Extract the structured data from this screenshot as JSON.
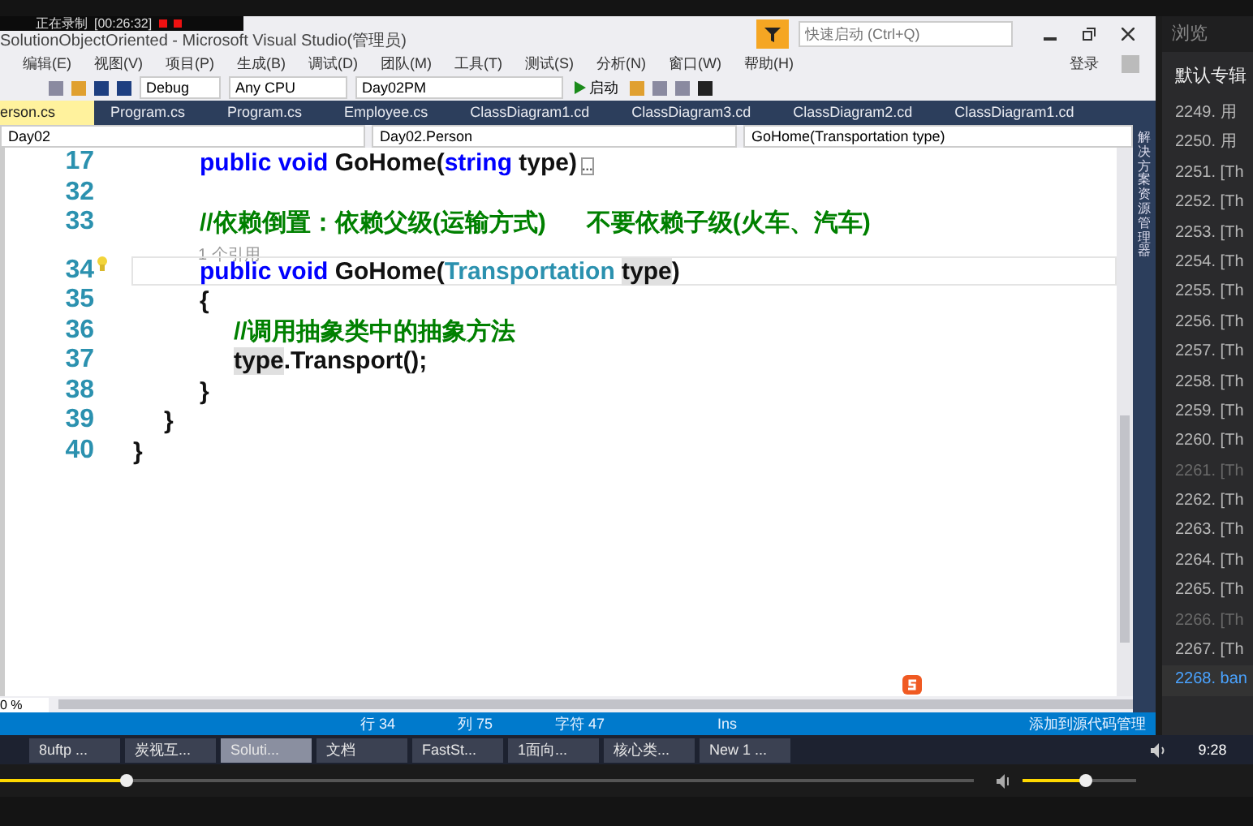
{
  "recording": {
    "label": "正在录制",
    "time": "[00:26:32]"
  },
  "window": {
    "title": "SolutionObjectOriented - Microsoft Visual Studio(管理员)",
    "quick_launch": {
      "placeholder": "快速启动 (Ctrl+Q)"
    },
    "login": "登录"
  },
  "menu": [
    "编辑(E)",
    "视图(V)",
    "项目(P)",
    "生成(B)",
    "调试(D)",
    "团队(M)",
    "工具(T)",
    "测试(S)",
    "分析(N)",
    "窗口(W)",
    "帮助(H)"
  ],
  "toolbar": {
    "configuration": "Debug",
    "platform": "Any CPU",
    "project": "Day02PM",
    "start": "启动"
  },
  "tabs": [
    {
      "label": "erson.cs",
      "selected": true
    },
    {
      "label": "Program.cs",
      "selected": false
    },
    {
      "label": "Program.cs",
      "selected": false
    },
    {
      "label": "Employee.cs",
      "selected": false
    },
    {
      "label": "ClassDiagram1.cd",
      "selected": false
    },
    {
      "label": "ClassDiagram3.cd",
      "selected": false
    },
    {
      "label": "ClassDiagram2.cd",
      "selected": false
    },
    {
      "label": "ClassDiagram1.cd",
      "selected": false
    }
  ],
  "nav": {
    "project": "Day02",
    "class": "Day02.Person",
    "member": "GoHome(Transportation type)"
  },
  "side_tab": "解决方案资源管理器",
  "code": [
    {
      "number": "17",
      "kind": "member",
      "current": false,
      "tokens": [
        {
          "text": "public void ",
          "kind": "keyword"
        },
        {
          "text": "GoHome(",
          "kind": "plain"
        },
        {
          "text": "string",
          "kind": "keyword"
        },
        {
          "text": " type)",
          "kind": "plain"
        },
        {
          "text": "...",
          "kind": "collapsed"
        }
      ]
    },
    {
      "number": "32",
      "kind": "member",
      "current": false
    },
    {
      "number": "33",
      "kind": "member",
      "current": false,
      "tokens": [
        {
          "text": "//依赖倒置：依赖父级(运输方式)      不要依赖子级(火车、汽车)",
          "kind": "comment"
        }
      ]
    },
    {
      "number": "34",
      "kind": "member",
      "current": true,
      "codelens": "1 个引用",
      "tokens": [
        {
          "text": "public void ",
          "kind": "keyword"
        },
        {
          "text": "GoHome(",
          "kind": "plain"
        },
        {
          "text": "Transportation ",
          "kind": "type"
        },
        {
          "text": "type",
          "kind": "highlight"
        },
        {
          "text": ")",
          "kind": "plain"
        }
      ]
    },
    {
      "number": "35",
      "kind": "member",
      "current": false,
      "tokens": [
        {
          "text": "{",
          "kind": "plain"
        }
      ]
    },
    {
      "number": "36",
      "kind": "body",
      "current": false,
      "tokens": [
        {
          "text": "//调用抽象类中的抽象方法",
          "kind": "comment"
        }
      ]
    },
    {
      "number": "37",
      "kind": "body",
      "current": false,
      "tokens": [
        {
          "text": "type",
          "kind": "highlight"
        },
        {
          "text": ".Transport();",
          "kind": "plain"
        }
      ]
    },
    {
      "number": "38",
      "kind": "member",
      "current": false,
      "tokens": [
        {
          "text": "}",
          "kind": "plain"
        }
      ]
    },
    {
      "number": "39",
      "kind": "class",
      "current": false,
      "tokens": [
        {
          "text": "}",
          "kind": "plain"
        }
      ]
    },
    {
      "number": "40",
      "kind": "namespace",
      "current": false,
      "tokens": [
        {
          "text": "}",
          "kind": "plain"
        }
      ]
    }
  ],
  "zoom": "0 %",
  "status_bar": {
    "line": "行 34",
    "column": "列 75",
    "char": "字符 47",
    "mode": "Ins",
    "source_control": "添加到源代码管理"
  },
  "taskbar": [
    {
      "label": "8uftp ...",
      "selected": false
    },
    {
      "label": "炭视互...",
      "selected": false
    },
    {
      "label": "Soluti...",
      "selected": true
    },
    {
      "label": "文档",
      "selected": false
    },
    {
      "label": "FastSt...",
      "selected": false
    },
    {
      "label": "1面向...",
      "selected": false
    },
    {
      "label": "核心类...",
      "selected": false
    },
    {
      "label": "New 1 ...",
      "selected": false
    }
  ],
  "clock": "9:28",
  "player": {
    "progress": {
      "level": 0.13
    },
    "volume": {
      "level": 0.55
    }
  },
  "panel": {
    "title": "浏览",
    "heading": "默认专辑",
    "items": [
      {
        "label": "2249. 用",
        "dimmed": false,
        "selected": false
      },
      {
        "label": "2250. 用",
        "dimmed": false,
        "selected": false
      },
      {
        "label": "2251. [Th",
        "dimmed": false,
        "selected": false
      },
      {
        "label": "2252. [Th",
        "dimmed": false,
        "selected": false
      },
      {
        "label": "2253. [Th",
        "dimmed": false,
        "selected": false
      },
      {
        "label": "2254. [Th",
        "dimmed": false,
        "selected": false
      },
      {
        "label": "2255. [Th",
        "dimmed": false,
        "selected": false
      },
      {
        "label": "2256. [Th",
        "dimmed": false,
        "selected": false
      },
      {
        "label": "2257. [Th",
        "dimmed": false,
        "selected": false
      },
      {
        "label": "2258. [Th",
        "dimmed": false,
        "selected": false
      },
      {
        "label": "2259. [Th",
        "dimmed": false,
        "selected": false
      },
      {
        "label": "2260. [Th",
        "dimmed": false,
        "selected": false
      },
      {
        "label": "2261. [Th",
        "dimmed": true,
        "selected": false
      },
      {
        "label": "2262. [Th",
        "dimmed": false,
        "selected": false
      },
      {
        "label": "2263. [Th",
        "dimmed": false,
        "selected": false
      },
      {
        "label": "2264. [Th",
        "dimmed": false,
        "selected": false
      },
      {
        "label": "2265. [Th",
        "dimmed": false,
        "selected": false
      },
      {
        "label": "2266. [Th",
        "dimmed": true,
        "selected": false
      },
      {
        "label": "2267. [Th",
        "dimmed": false,
        "selected": false
      },
      {
        "label": "2268. ban",
        "dimmed": false,
        "selected": true
      }
    ]
  }
}
